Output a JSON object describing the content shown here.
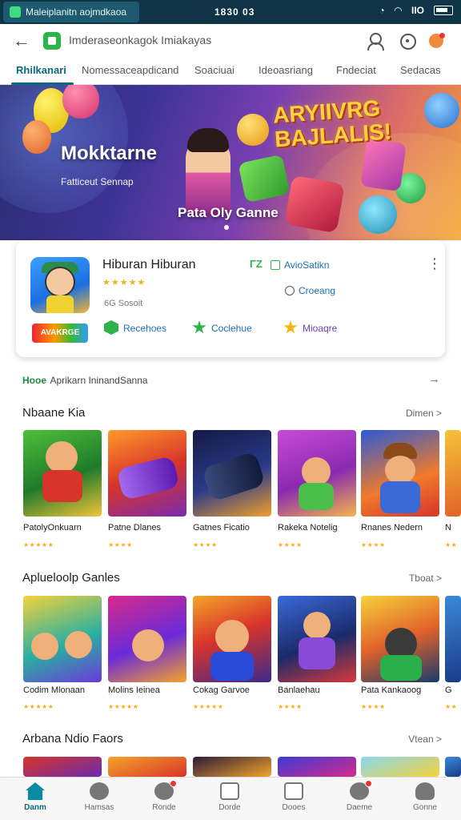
{
  "status": {
    "notification": "Maleiplanitn aojmdkaoa",
    "time": "1830 03",
    "battery_label": "IIO"
  },
  "topbar": {
    "search_text": "Imderaseonkagok Imiakayas"
  },
  "tabs": [
    "Rhilkanari",
    "Nomessaceapdicand",
    "Soaciuai",
    "Ideoasriang",
    "Fndeciat",
    "Sedacas"
  ],
  "banner": {
    "title": "Mokktarne",
    "subtitle": "Fatticeut Sennap",
    "cta": "Pata Oly Ganne",
    "headline": "ARYIIVRG BAJLALIS!"
  },
  "app_card": {
    "name": "Hiburan Hiburan",
    "stars": "★★★★★",
    "meta": "6G Sosoit",
    "tag": "AVAKRGE CLARTE",
    "badge": "ΓΖ",
    "link1": "AvioSatikn",
    "link2": "Croeang",
    "chips": [
      "Recehoes",
      "Coclehue",
      "Mioaqre"
    ]
  },
  "recommend": {
    "tag": "Hooe",
    "title": "Aprikarn IninandSanna"
  },
  "sections": [
    {
      "title": "Nbaane Kia",
      "more": "Dimen >",
      "items": [
        {
          "title": "PatolyOnkuarn",
          "stars": "★★★★★"
        },
        {
          "title": "Patne Dlanes",
          "stars": "★★★★"
        },
        {
          "title": "Gatnes Ficatio",
          "stars": "★★★★"
        },
        {
          "title": "Rakeka Notelig",
          "stars": "★★★★"
        },
        {
          "title": "Rnanes Nedern",
          "stars": "★★★★"
        },
        {
          "title": "N",
          "stars": "★★"
        }
      ]
    },
    {
      "title": "Aplueloolp Ganles",
      "more": "Tboat >",
      "items": [
        {
          "title": "Codim Mlonaan",
          "stars": "★★★★★"
        },
        {
          "title": "Molins Ieinea",
          "stars": "★★★★★"
        },
        {
          "title": "Cokag Garvoe",
          "stars": "★★★★★"
        },
        {
          "title": "Banlaehau",
          "stars": "★★★★"
        },
        {
          "title": "Pata Kankaoog",
          "stars": "★★★★"
        },
        {
          "title": "G",
          "stars": "★★"
        }
      ]
    },
    {
      "title": "Arbana Ndio Faors",
      "more": "Vtean >",
      "items": []
    }
  ],
  "bottom_nav": [
    "Danm",
    "Hamsas",
    "Ronde",
    "Dorde",
    "Dooes",
    "Daeme",
    "Gonne"
  ],
  "colors": {
    "accent": "#0a6a77",
    "status_bar": "#0f3447",
    "star": "#f2b01e",
    "link": "#1a6fb3"
  }
}
